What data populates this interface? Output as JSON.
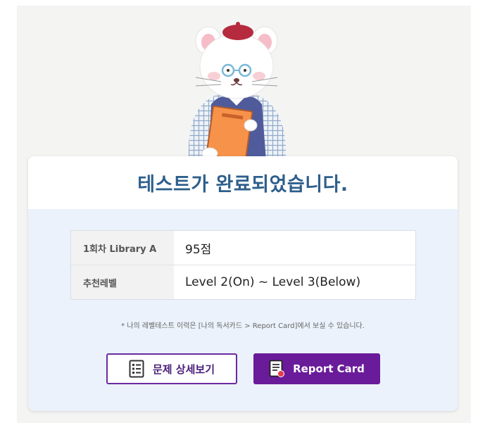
{
  "result": {
    "title": "테스트가 완료되었습니다.",
    "rows": [
      {
        "label": "1회차 Library A",
        "value": "95점"
      },
      {
        "label": "추천레벨",
        "value": "Level 2(On) ~ Level 3(Below)"
      }
    ],
    "notice": "* 나의 레벨테스트 이력은 [나의 독서카드 > Report Card]에서 보실 수 있습니다."
  },
  "buttons": {
    "detail_label": "문제 상세보기",
    "report_label": "Report Card"
  },
  "colors": {
    "title": "#2e5f8c",
    "accent_purple": "#6a1b9a",
    "panel_bg": "#ebf2fb"
  },
  "icons": {
    "detail": "document-list-icon",
    "report": "report-card-icon",
    "mascot": "cat-teacher-mascot"
  }
}
